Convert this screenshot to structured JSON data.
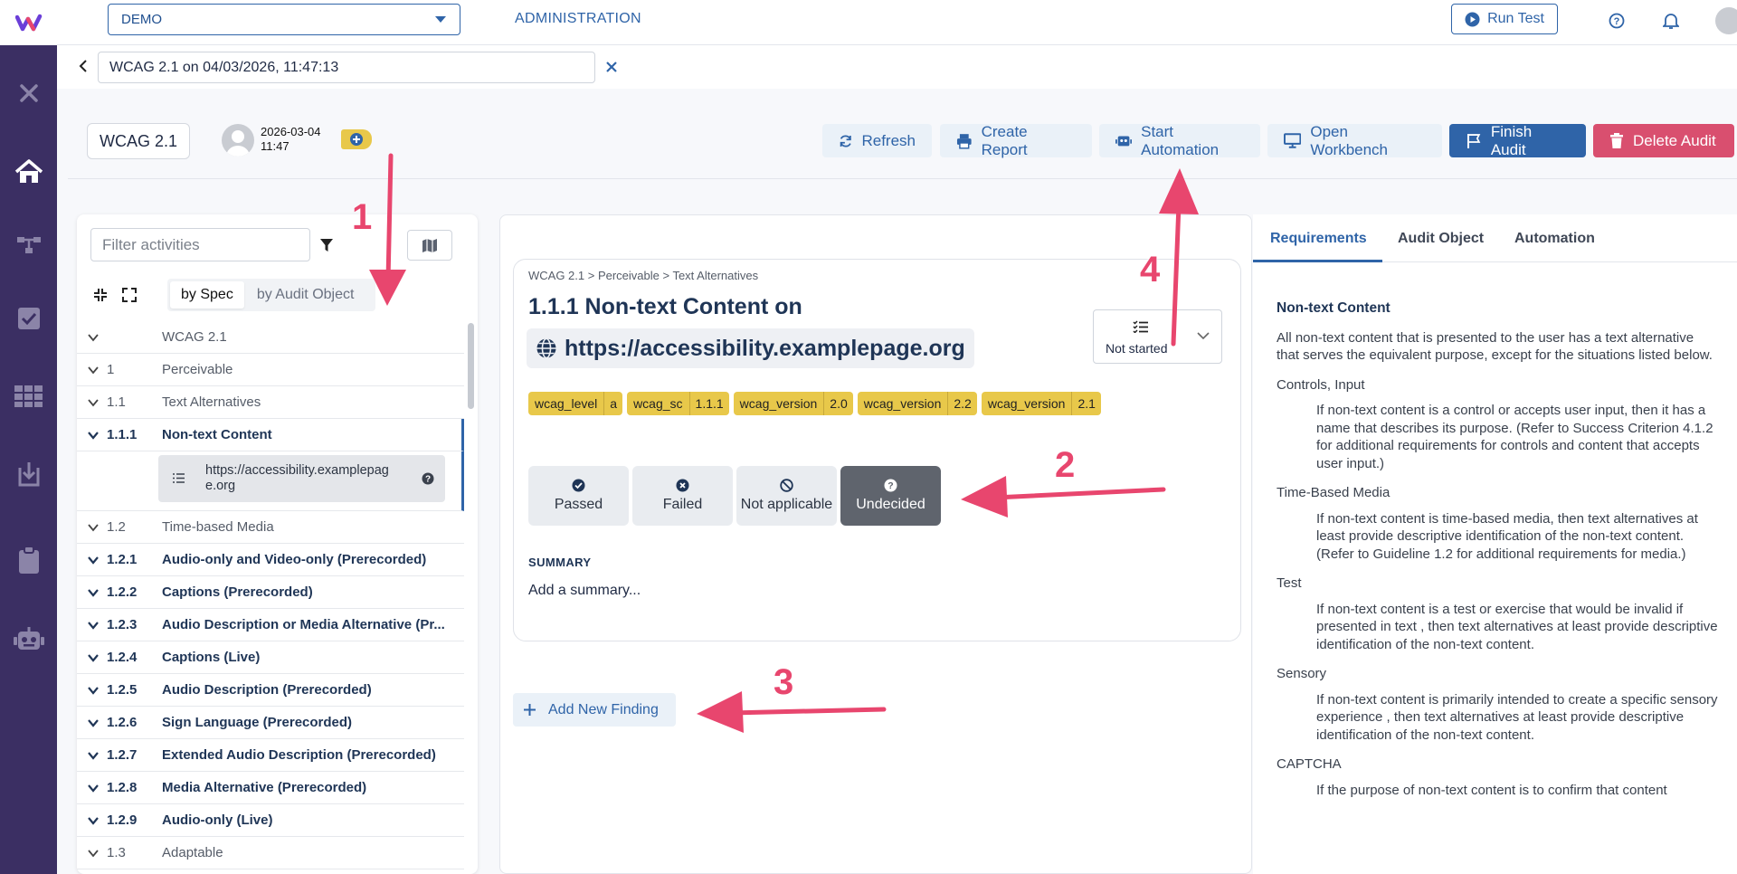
{
  "topbar": {
    "project_select": "DEMO",
    "administration": "ADMINISTRATION",
    "run_test": "Run Test"
  },
  "breadcrumb": {
    "audit_name_value": "WCAG 2.1 on 04/03/2026, 11:47:13"
  },
  "audit_header": {
    "spec_pill": "WCAG 2.1",
    "date": "2026-03-04",
    "time": "11:47",
    "buttons": {
      "refresh": "Refresh",
      "create_report": "Create Report",
      "start_automation": "Start Automation",
      "open_workbench": "Open Workbench",
      "finish_audit": "Finish Audit",
      "delete_audit": "Delete Audit"
    }
  },
  "left_panel": {
    "filter_placeholder": "Filter activities",
    "segment": {
      "by_spec": "by Spec",
      "by_audit_object": "by Audit Object"
    },
    "tree": [
      {
        "num": "",
        "label": "WCAG 2.1",
        "bold": false
      },
      {
        "num": "1",
        "label": "Perceivable",
        "bold": false
      },
      {
        "num": "1.1",
        "label": "Text Alternatives",
        "bold": false
      },
      {
        "num": "1.1.1",
        "label": "Non-text Content",
        "bold": true,
        "selected": true
      },
      {
        "num": "1.2",
        "label": "Time-based Media",
        "bold": false
      },
      {
        "num": "1.2.1",
        "label": "Audio-only and Video-only (Prerecorded)",
        "bold": true
      },
      {
        "num": "1.2.2",
        "label": "Captions (Prerecorded)",
        "bold": true
      },
      {
        "num": "1.2.3",
        "label": "Audio Description or Media Alternative (Pr...",
        "bold": true
      },
      {
        "num": "1.2.4",
        "label": "Captions (Live)",
        "bold": true
      },
      {
        "num": "1.2.5",
        "label": "Audio Description (Prerecorded)",
        "bold": true
      },
      {
        "num": "1.2.6",
        "label": "Sign Language (Prerecorded)",
        "bold": true
      },
      {
        "num": "1.2.7",
        "label": "Extended Audio Description (Prerecorded)",
        "bold": true
      },
      {
        "num": "1.2.8",
        "label": "Media Alternative (Prerecorded)",
        "bold": true
      },
      {
        "num": "1.2.9",
        "label": "Audio-only (Live)",
        "bold": true
      },
      {
        "num": "1.3",
        "label": "Adaptable",
        "bold": false
      }
    ],
    "sub_item": "https://accessibility.examplepag e.org"
  },
  "center": {
    "crumbs": "WCAG 2.1 > Perceivable > Text Alternatives",
    "title": "1.1.1 Non-text Content on",
    "url": "https://accessibility.examplepage.org",
    "status": "Not started",
    "tags": [
      {
        "k": "wcag_level",
        "v": "a"
      },
      {
        "k": "wcag_sc",
        "v": "1.1.1"
      },
      {
        "k": "wcag_version",
        "v": "2.0"
      },
      {
        "k": "wcag_version",
        "v": "2.2"
      },
      {
        "k": "wcag_version",
        "v": "2.1"
      }
    ],
    "verdicts": {
      "passed": "Passed",
      "failed": "Failed",
      "not_applicable": "Not applicable",
      "undecided": "Undecided"
    },
    "summary_heading": "SUMMARY",
    "summary_placeholder": "Add a summary...",
    "add_finding": "Add New Finding"
  },
  "right_panel": {
    "tabs": {
      "requirements": "Requirements",
      "audit_object": "Audit Object",
      "automation": "Automation"
    },
    "heading": "Non-text Content",
    "intro": "All non-text content that is presented to the user has a text alternative that serves the equivalent purpose, except for the situations listed below.",
    "sections": [
      {
        "title": "Controls, Input",
        "text": "If non-text content is a control or accepts user input, then it has a name that describes its purpose. (Refer to Success Criterion 4.1.2 for additional requirements for controls and content that accepts user input.)"
      },
      {
        "title": "Time-Based Media",
        "text": "If non-text content is time-based media, then text alternatives at least provide descriptive identification of the non-text content. (Refer to Guideline 1.2 for additional requirements for media.)"
      },
      {
        "title": "Test",
        "text": "If non-text content is a test or exercise that would be invalid if presented in text , then text alternatives at least provide descriptive identification of the non-text content."
      },
      {
        "title": "Sensory",
        "text": "If non-text content is primarily intended to create a specific sensory experience , then text alternatives at least provide descriptive identification of the non-text content."
      },
      {
        "title": "CAPTCHA",
        "text": "If the purpose of non-text content is to confirm that content"
      }
    ]
  },
  "annotations": {
    "a1": "1",
    "a2": "2",
    "a3": "3",
    "a4": "4"
  },
  "colors": {
    "brand": "#3b2f63",
    "accent": "#2f64a8",
    "danger": "#d94f6f",
    "tag": "#e8c84a",
    "annotation": "#e8466e"
  }
}
